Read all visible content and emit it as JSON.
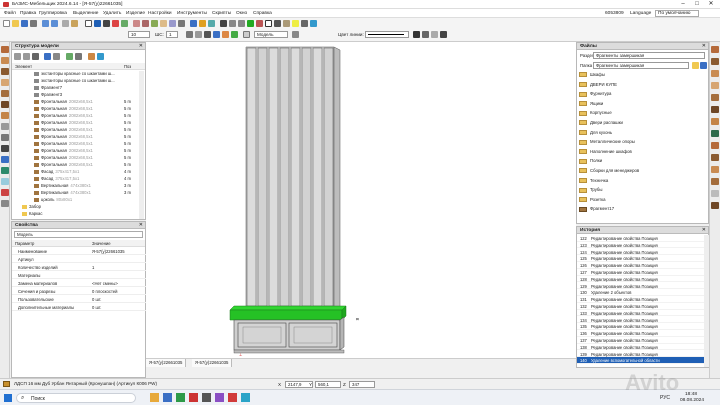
{
  "window": {
    "title": "БАЗИС-Мебельщик 2024.6.14 - [Я-57(у)22661035]",
    "min": "–",
    "max": "□",
    "close": "✕"
  },
  "menu": [
    "Файл",
    "Правка",
    "Группировка",
    "Выделение",
    "Удалить",
    "Изделие",
    "Настройки",
    "Инструменты",
    "Скрипты",
    "Окно",
    "Справка"
  ],
  "menu_right": {
    "id": "6053809",
    "language": "Language",
    "layout": "По умолчанию"
  },
  "toolbar": {
    "size_value": "10",
    "shc_label": "ШС:",
    "shc_value": "1",
    "model_label": "Модель",
    "line_color_label": "Цвет линии:"
  },
  "structure_panel": {
    "title": "Структура модели",
    "col_element": "Элемент",
    "col_pos": "Поз",
    "rows": [
      {
        "label": "экстанторы красные со шкантами ш...",
        "num": "",
        "dim": ""
      },
      {
        "label": "экстанторы красные со шкантами ш...",
        "num": "",
        "dim": ""
      },
      {
        "label": "Фрагмент7",
        "num": "",
        "dim": ""
      },
      {
        "label": "Фрагмент3",
        "num": "",
        "dim": ""
      },
      {
        "label": "Фронтальная",
        "num": "5 m",
        "dim": "2082x68,5x1"
      },
      {
        "label": "Фронтальная",
        "num": "5 m",
        "dim": "2082x68,5x1"
      },
      {
        "label": "Фронтальная",
        "num": "5 m",
        "dim": "2082x68,5x1"
      },
      {
        "label": "Фронтальная",
        "num": "5 m",
        "dim": "2082x68,5x1"
      },
      {
        "label": "Фронтальная",
        "num": "5 m",
        "dim": "2082x68,5x1"
      },
      {
        "label": "Фронтальная",
        "num": "5 m",
        "dim": "2082x68,5x1"
      },
      {
        "label": "Фронтальная",
        "num": "5 m",
        "dim": "2082x68,5x1"
      },
      {
        "label": "Фронтальная",
        "num": "5 m",
        "dim": "2082x68,5x1"
      },
      {
        "label": "Фронтальная",
        "num": "5 m",
        "dim": "2082x68,5x1"
      },
      {
        "label": "Фронтальная",
        "num": "5 m",
        "dim": "2082x68,5x1"
      },
      {
        "label": "Фасад",
        "num": "4 m",
        "dim": "375x417,5x1"
      },
      {
        "label": "Фасад",
        "num": "4 m",
        "dim": "375x417,5x1"
      },
      {
        "label": "Вертикальная",
        "num": "3 m",
        "dim": "474x380x1"
      },
      {
        "label": "Вертикальная",
        "num": "3 m",
        "dim": "474x380x1"
      },
      {
        "label": "цоколь",
        "num": "",
        "dim": "80x80x1"
      },
      {
        "label": "Забор",
        "num": "",
        "dim": ""
      },
      {
        "label": "Каркас",
        "num": "",
        "dim": ""
      }
    ]
  },
  "properties_panel": {
    "title": "Свойства",
    "subtitle": "Модель",
    "col_param": "Параметр",
    "col_value": "Значение",
    "rows": [
      {
        "k": "Наименование",
        "v": "Я-57(у)22661035"
      },
      {
        "k": "Артикул",
        "v": ""
      },
      {
        "k": "Количество изделий",
        "v": "1"
      },
      {
        "k": "Материалы",
        "v": ""
      },
      {
        "k": "Замена материалов",
        "v": "<Нет смены>"
      },
      {
        "k": "Сечения и разрезы",
        "v": "0 плоскостей"
      },
      {
        "k": "Пользовательские",
        "v": "0 шт."
      },
      {
        "k": "Дополнительные материалы",
        "v": "0 шт."
      }
    ]
  },
  "files_panel": {
    "title": "Файлы",
    "section_label": "Раздел",
    "section_value": "Фрагменты замершикая",
    "folder_label": "Папка",
    "folder_value": "Фрагменты замершикая",
    "items": [
      "Шкафы",
      "ДВЕРИ КУПЕ",
      "Фурнитура",
      "Ящики",
      "Корпусные",
      "Двери распашки",
      "Для кухонь",
      "Металлические опоры",
      "Наполнение шкафов",
      "Полки",
      "Сборки для менеджеров",
      "Техничка",
      "Трубы",
      "Розетка",
      "Фрагмент17"
    ]
  },
  "history_panel": {
    "title": "История",
    "rows": [
      {
        "n": "122",
        "t": "Редактирование свойства Позиция"
      },
      {
        "n": "123",
        "t": "Редактирование свойства Позиция"
      },
      {
        "n": "124",
        "t": "Редактирование свойства Позиция"
      },
      {
        "n": "125",
        "t": "Редактирование свойства Позиция"
      },
      {
        "n": "126",
        "t": "Редактирование свойства Позиция"
      },
      {
        "n": "127",
        "t": "Редактирование свойства Позиция"
      },
      {
        "n": "128",
        "t": "Редактирование свойства Позиция"
      },
      {
        "n": "129",
        "t": "Редактирование свойства Позиция"
      },
      {
        "n": "130",
        "t": "Удаление 2 объектов"
      },
      {
        "n": "131",
        "t": "Редактирование свойства Позиция"
      },
      {
        "n": "132",
        "t": "Редактирование свойства Позиция"
      },
      {
        "n": "133",
        "t": "Редактирование свойства Позиция"
      },
      {
        "n": "134",
        "t": "Редактирование свойства Позиция"
      },
      {
        "n": "135",
        "t": "Редактирование свойства Позиция"
      },
      {
        "n": "136",
        "t": "Редактирование свойства Позиция"
      },
      {
        "n": "137",
        "t": "Редактирование свойства Позиция"
      },
      {
        "n": "138",
        "t": "Редактирование свойства Позиция"
      },
      {
        "n": "139",
        "t": "Редактирование свойства Позиция"
      },
      {
        "n": "140",
        "t": "Удаление вспомогательной области"
      }
    ]
  },
  "view_tabs": [
    "Я-57(у)22661035",
    "Я-57(у)22661035"
  ],
  "status": {
    "material": "ЛДСП 16 мм Дуб Урбан Янтарный (Кронушпан) (Артикул К006 PW)",
    "x_label": "X",
    "x_value": "2147,9",
    "y_label": "Y",
    "y_value": "560,1",
    "z_label": "Z",
    "z_value": "347"
  },
  "taskbar": {
    "search": "Поиск",
    "lang": "РУС",
    "time": "18:48",
    "date": "08.08.2024",
    "watermark": "Avito"
  },
  "colors": {
    "green_top": "#29d829",
    "panel_gray": "#c8c8c8",
    "accent_blue": "#1f5fb5"
  }
}
